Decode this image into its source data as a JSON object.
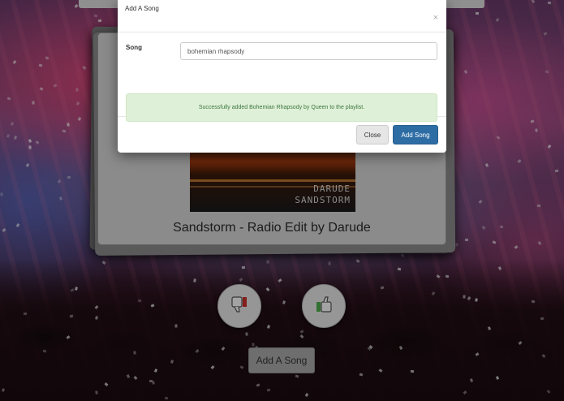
{
  "modal": {
    "title": "Add A Song",
    "close_glyph": "×",
    "song_label": "Song",
    "song_input_value": "bohemian rhapsody",
    "success_message": "Successfully added Bohemian Rhapsody by Queen to the playlist.",
    "close_button": "Close",
    "add_button": "Add Song"
  },
  "now_playing": {
    "album_art_text_1": "DARUDE",
    "album_art_text_2": "SANDSTORM",
    "track_title": "Sandstorm - Radio Edit by Darude"
  },
  "vote": {
    "down_icon": "thumbs-down-icon",
    "up_icon": "thumbs-up-icon"
  },
  "footer": {
    "add_song_button": "Add A Song"
  },
  "colors": {
    "primary": "#2e6da4",
    "success_bg": "#dff0d8",
    "success_text": "#3c763d",
    "thumb_down": "#c9302c",
    "thumb_up": "#4cae4c"
  }
}
